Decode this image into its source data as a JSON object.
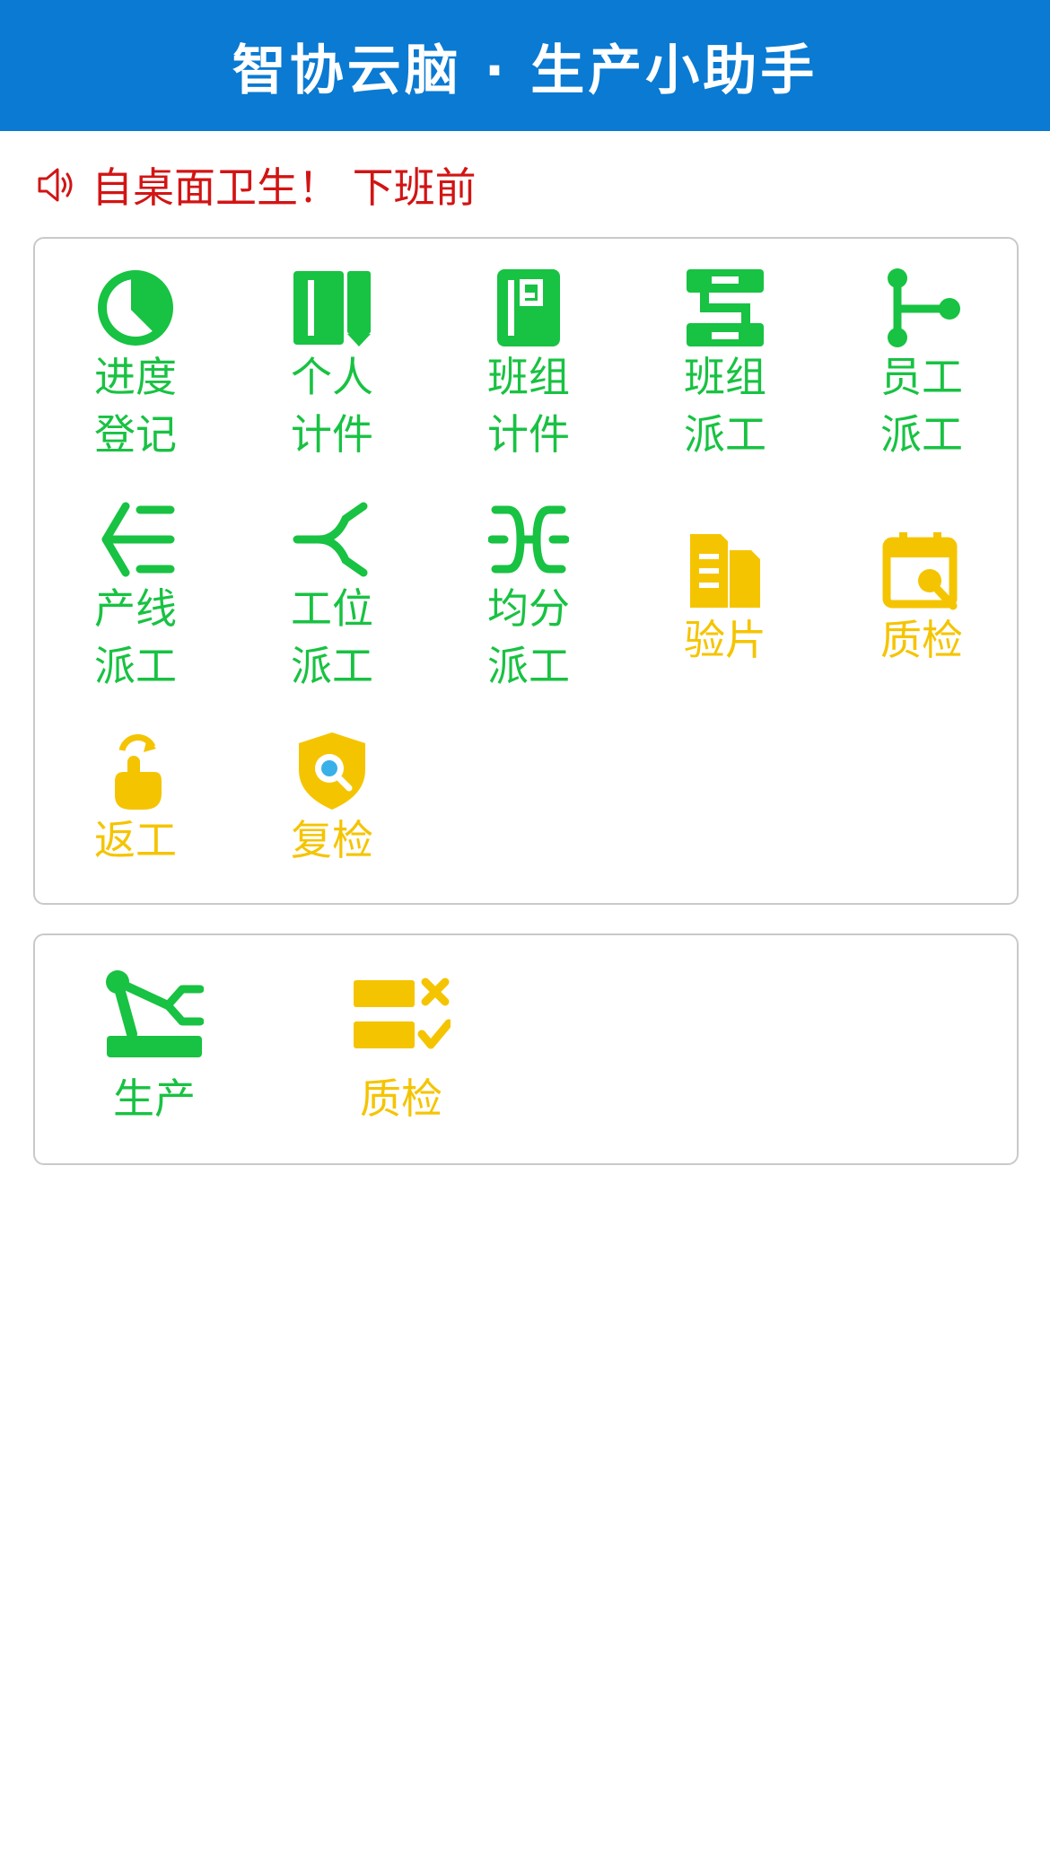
{
  "header": {
    "title": "智协云脑 · 生产小助手"
  },
  "notice": {
    "text": "自桌面卫生！ 下班前",
    "color": "#d21414",
    "icon": "speaker-icon"
  },
  "colors": {
    "header_bg": "#0a7ad2",
    "green": "#18c242",
    "yellow": "#f5c400"
  },
  "grid1": [
    {
      "line1": "进度",
      "line2": "登记",
      "icon": "pie-chart-icon"
    },
    {
      "line1": "个人",
      "line2": "计件",
      "icon": "book-icon"
    },
    {
      "line1": "班组",
      "line2": "计件",
      "icon": "notebook-icon"
    },
    {
      "line1": "班组",
      "line2": "派工",
      "icon": "flow-icon"
    },
    {
      "line1": "员工",
      "line2": "派工",
      "icon": "branch-icon"
    },
    {
      "line1": "产线",
      "line2": "派工",
      "icon": "split-line-icon"
    },
    {
      "line1": "工位",
      "line2": "派工",
      "icon": "fork-icon"
    },
    {
      "line1": "均分",
      "line2": "派工",
      "icon": "merge-icon"
    },
    {
      "line1": "验片",
      "line2": "",
      "icon": "sheets-icon"
    },
    {
      "line1": "质检",
      "line2": "",
      "icon": "calendar-search-icon"
    },
    {
      "line1": "返工",
      "line2": "",
      "icon": "hand-redo-icon"
    },
    {
      "line1": "复检",
      "line2": "",
      "icon": "shield-search-icon"
    }
  ],
  "grid2": [
    {
      "label": "生产",
      "icon": "robot-arm-icon"
    },
    {
      "label": "质检",
      "icon": "checklist-icon"
    }
  ]
}
